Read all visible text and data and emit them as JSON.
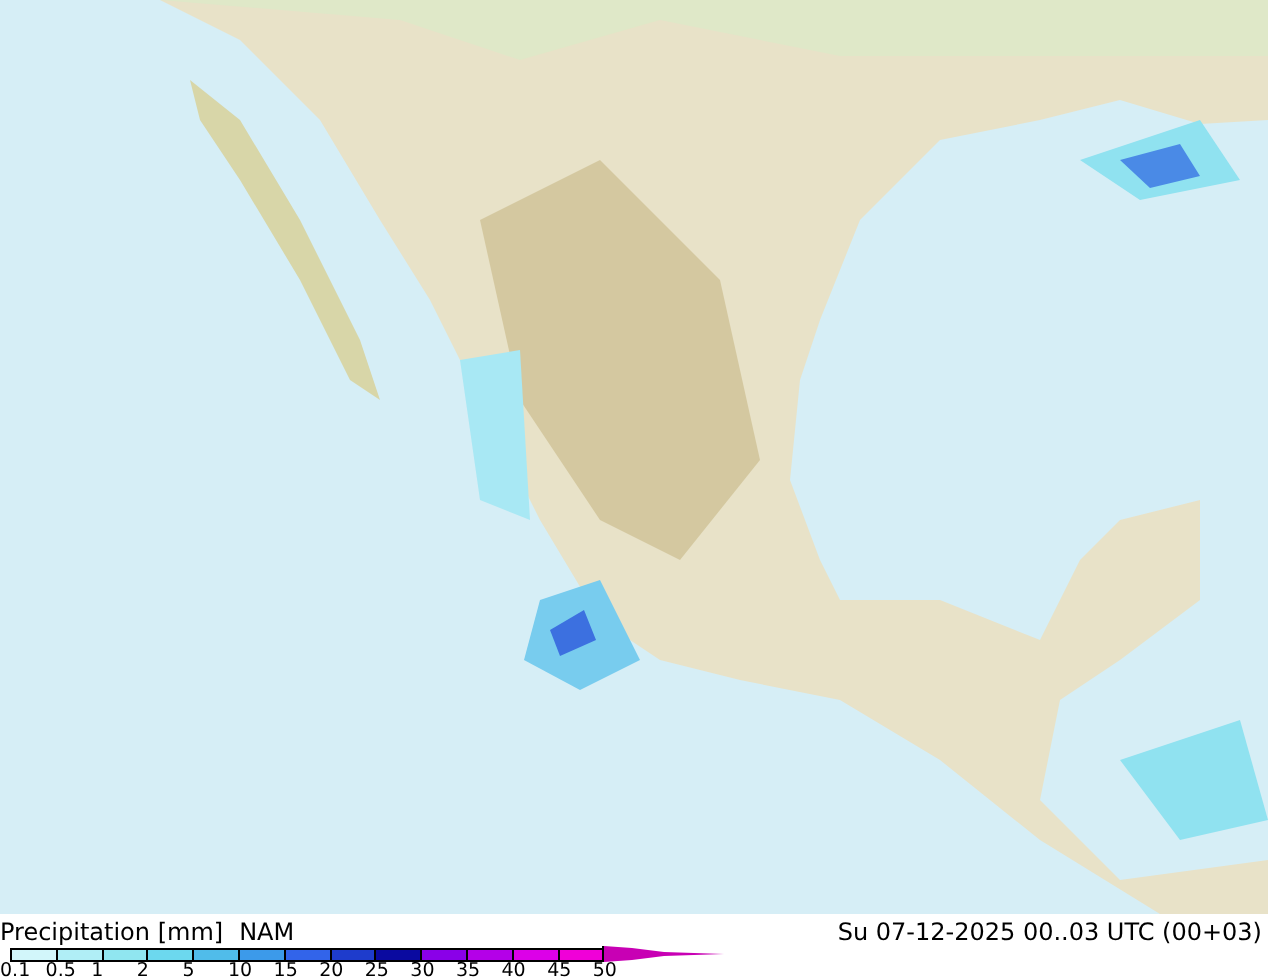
{
  "title": {
    "variable": "Precipitation [mm]",
    "model": "NAM",
    "time": "Su 07-12-2025 00..03 UTC (00+03)"
  },
  "legend": [
    {
      "label": "0.1",
      "color": "#d2f6fa"
    },
    {
      "label": "0.5",
      "color": "#b0eef6"
    },
    {
      "label": "1",
      "color": "#90e6f0"
    },
    {
      "label": "2",
      "color": "#6cd8ee"
    },
    {
      "label": "5",
      "color": "#50bcea"
    },
    {
      "label": "10",
      "color": "#3c9aea"
    },
    {
      "label": "15",
      "color": "#3264ea"
    },
    {
      "label": "20",
      "color": "#1e3ccc"
    },
    {
      "label": "25",
      "color": "#0a0aa0"
    },
    {
      "label": "30",
      "color": "#8a00e8"
    },
    {
      "label": "35",
      "color": "#b400e8"
    },
    {
      "label": "40",
      "color": "#dc00e8"
    },
    {
      "label": "45",
      "color": "#f000d8"
    },
    {
      "label": "50",
      "color": "#c800b4"
    }
  ]
}
